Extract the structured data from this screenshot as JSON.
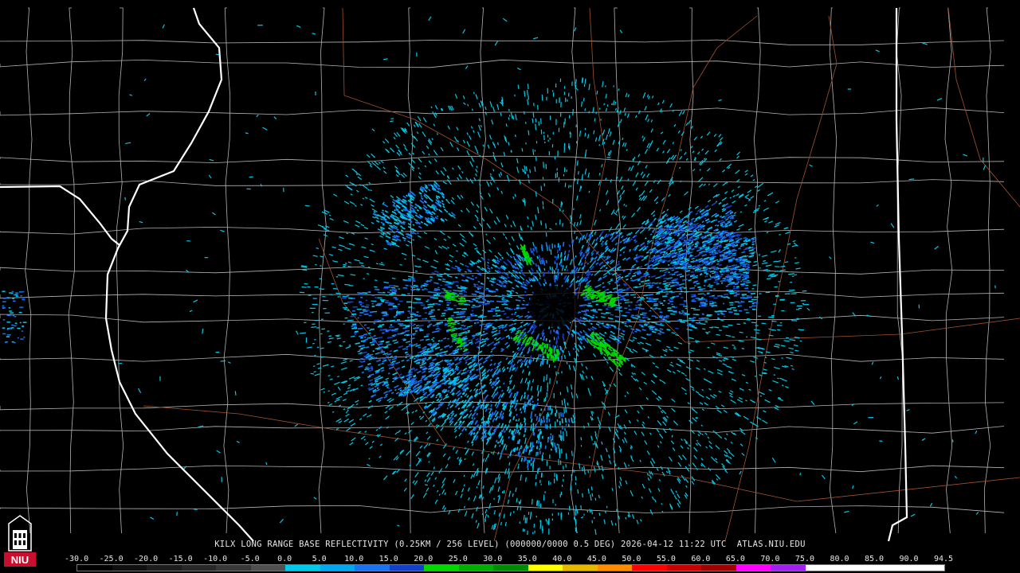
{
  "product": {
    "caption": "KILX LONG RANGE BASE REFLECTIVITY (0.25KM / 256 LEVEL) (000000/0000 0.5 DEG) 2026-04-12 11:22 UTC  ATLAS.NIU.EDU"
  },
  "logo": {
    "text": "NIU",
    "color": "#c8102e"
  },
  "colorbar": {
    "labels": [
      "-30.0",
      "-25.0",
      "-20.0",
      "-15.0",
      "-10.0",
      "-5.0",
      "0.0",
      "5.0",
      "10.0",
      "15.0",
      "20.0",
      "25.0",
      "30.0",
      "35.0",
      "40.0",
      "45.0",
      "50.0",
      "55.0",
      "60.0",
      "65.0",
      "70.0",
      "75.0",
      "80.0",
      "85.0",
      "90.0",
      "94.5"
    ],
    "segments": [
      "#000000",
      "#101010",
      "#1c1c1c",
      "#282828",
      "#383838",
      "#505050",
      "#00c8e6",
      "#00a6ee",
      "#1a72f0",
      "#1440c8",
      "#00d800",
      "#00b000",
      "#008c00",
      "#ffff00",
      "#e6b800",
      "#ff8c00",
      "#ff0000",
      "#c80000",
      "#a00000",
      "#ff00ff",
      "#a020f0",
      "#ffffff",
      "#ffffff",
      "#ffffff",
      "#ffffff"
    ]
  },
  "colors": {
    "county_lines": "#b4b4b4",
    "state_lines": "#ffffff",
    "roads": "#a0522d",
    "echo_light": "#00c8e6",
    "echo_medium": "#1a72f0",
    "echo_dark": "#1440c8",
    "echo_green": "#00d800"
  }
}
